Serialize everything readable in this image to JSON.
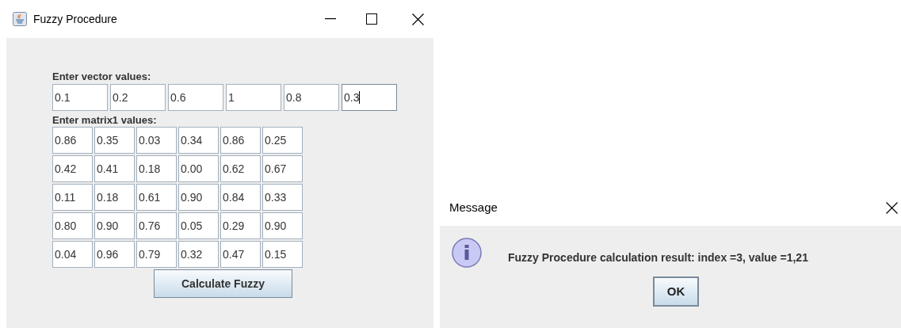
{
  "window": {
    "title": "Fuzzy Procedure"
  },
  "vector": {
    "label": "Enter vector values:",
    "fields": [
      {
        "value": "0.1",
        "focused": false
      },
      {
        "value": "0.2",
        "focused": false
      },
      {
        "value": "0.6",
        "focused": false
      },
      {
        "value": "1",
        "focused": false
      },
      {
        "value": "0.8",
        "focused": false
      },
      {
        "value": "0.3",
        "focused": true
      }
    ]
  },
  "matrix": {
    "label": "Enter matrix1 values:",
    "rows": [
      [
        "0.86",
        "0.35",
        "0.03",
        "0.34",
        "0.86",
        "0.25"
      ],
      [
        "0.42",
        "0.41",
        "0.18",
        "0.00",
        "0.62",
        "0.67"
      ],
      [
        "0.11",
        "0.18",
        "0.61",
        "0.90",
        "0.84",
        "0.33"
      ],
      [
        "0.80",
        "0.90",
        "0.76",
        "0.05",
        "0.29",
        "0.90"
      ],
      [
        "0.04",
        "0.96",
        "0.79",
        "0.32",
        "0.47",
        "0.15"
      ]
    ]
  },
  "calculate_button": "Calculate Fuzzy",
  "dialog": {
    "title": "Message",
    "message": "Fuzzy Procedure calculation result: index =3, value =1,21",
    "button": "OK"
  }
}
